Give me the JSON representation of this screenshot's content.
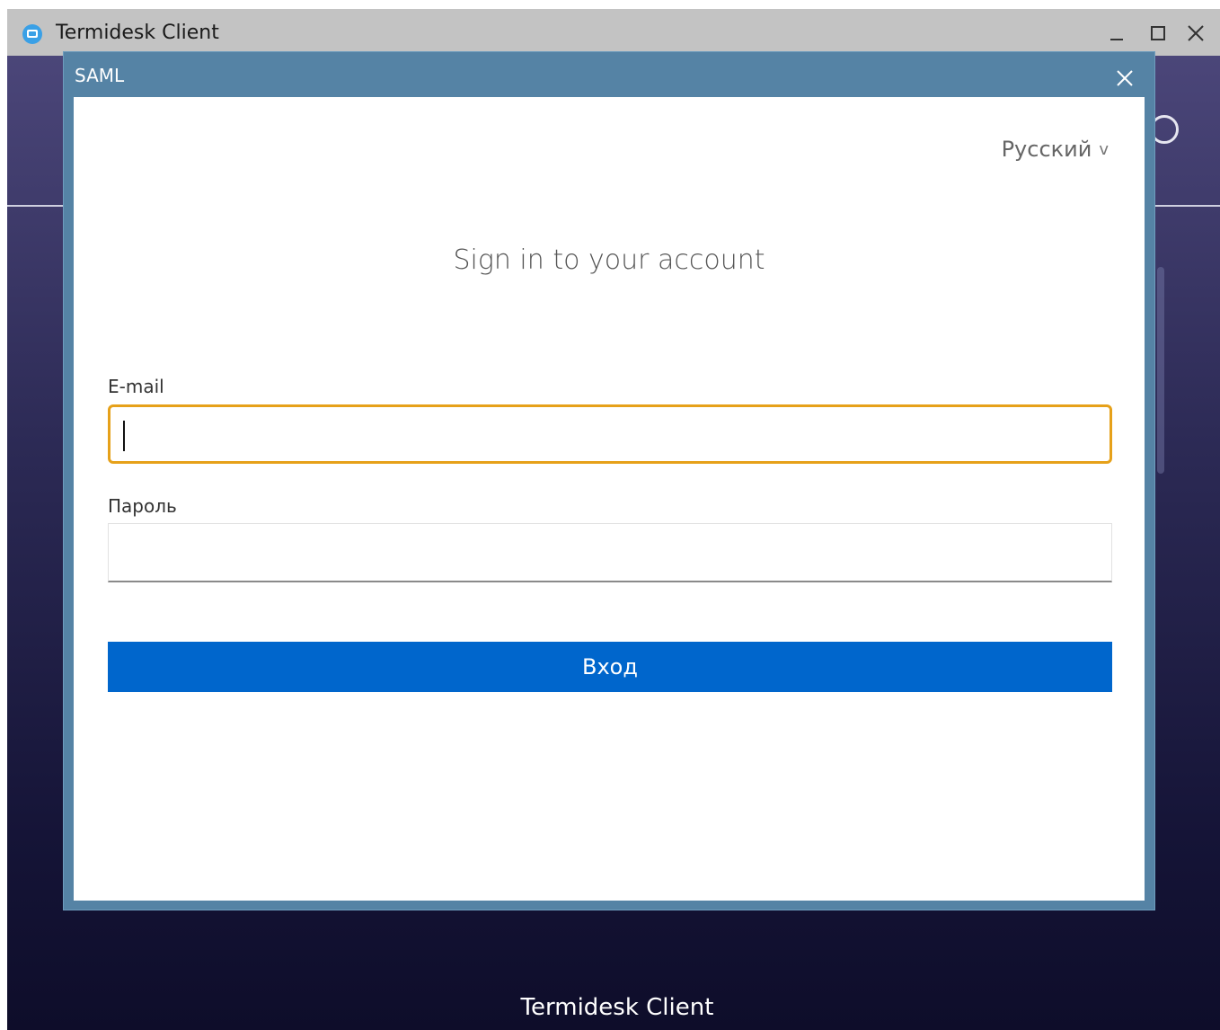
{
  "window": {
    "title": "Termidesk Client",
    "logo_icon": "termidesk-logo-icon",
    "controls": {
      "minimize": "_",
      "maximize": "□",
      "close": "✕"
    }
  },
  "app": {
    "footer_title": "Termidesk Client"
  },
  "dialog": {
    "title": "SAML",
    "close_icon": "close-icon",
    "language": {
      "selected": "Русский",
      "chevron": "v"
    },
    "heading": "Sign in to your account",
    "email": {
      "label": "E-mail",
      "value": "",
      "placeholder": ""
    },
    "password": {
      "label": "Пароль",
      "value": "",
      "placeholder": ""
    },
    "submit_label": "Вход"
  },
  "colors": {
    "dialog_frame": "#5583a5",
    "focus_border": "#e6a11a",
    "primary_button": "#0066cc",
    "app_background_top": "#4b4679",
    "app_background_bottom": "#0e0d2a"
  }
}
